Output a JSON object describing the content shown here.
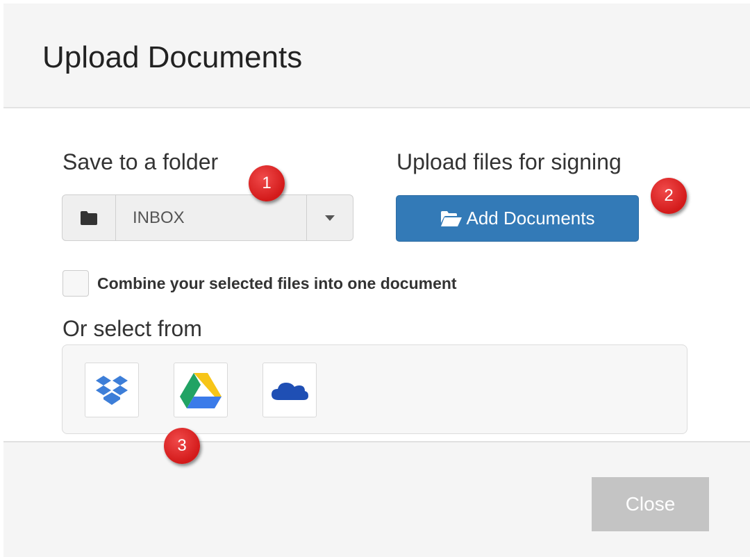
{
  "dialog": {
    "title": "Upload Documents"
  },
  "folder": {
    "label": "Save to a folder",
    "value": "INBOX",
    "icon": "folder-icon",
    "caret_icon": "caret-down-icon"
  },
  "upload": {
    "label": "Upload files for signing",
    "button_label": "Add Documents",
    "button_icon": "folder-open-icon",
    "color": "#337ab7"
  },
  "combine": {
    "label": "Combine your selected files into one document",
    "checked": false
  },
  "sources": {
    "label": "Or select from",
    "items": [
      {
        "name": "Dropbox",
        "icon": "dropbox-icon"
      },
      {
        "name": "Google Drive",
        "icon": "google-drive-icon"
      },
      {
        "name": "OneDrive",
        "icon": "onedrive-icon"
      }
    ]
  },
  "footer": {
    "close_label": "Close"
  },
  "badges": [
    "1",
    "2",
    "3"
  ]
}
